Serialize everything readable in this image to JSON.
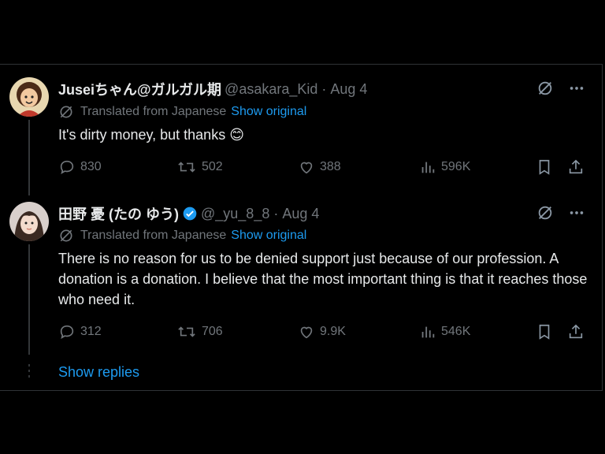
{
  "tweets": [
    {
      "name": "Juseiちゃん@ガルガル期",
      "handle": "@asakara_Kid",
      "date": "Aug 4",
      "translated_label": "Translated from Japanese",
      "show_original": "Show original",
      "text": "It's dirty money, but thanks",
      "emoji": "😊",
      "replies": "830",
      "reposts": "502",
      "likes": "388",
      "views": "596K"
    },
    {
      "name": "田野 憂 (たの ゆう)",
      "handle": "@_yu_8_8",
      "date": "Aug 4",
      "translated_label": "Translated from Japanese",
      "show_original": "Show original",
      "text": "There is no reason for us to be denied support just because of our profession. A donation is a donation. I believe that the most important thing is that it reaches those who need it.",
      "replies": "312",
      "reposts": "706",
      "likes": "9.9K",
      "views": "546K"
    }
  ],
  "show_replies": "Show replies",
  "colors": {
    "accent": "#1d9bf0",
    "muted": "#71767b",
    "text": "#e7e9ea",
    "background": "#000000"
  }
}
